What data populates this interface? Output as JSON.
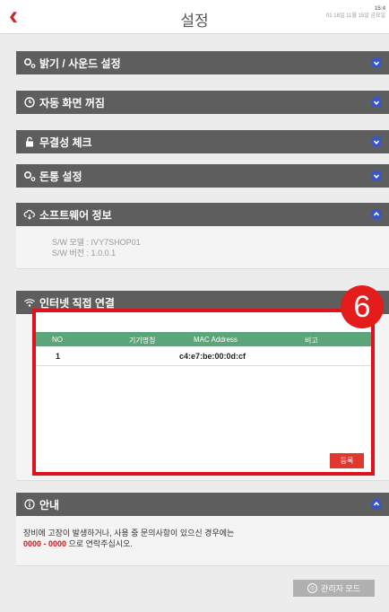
{
  "header": {
    "title": "설정",
    "clock_time": "15:4",
    "clock_date": "01 16일 11월 15일 금요일"
  },
  "sections": {
    "brightness": {
      "label": "밝기 / 사운드 설정"
    },
    "auto_off": {
      "label": "자동 화면 꺼짐"
    },
    "integrity": {
      "label": "무결성 체크"
    },
    "money": {
      "label": "돈통 설정"
    },
    "software": {
      "label": "소프트웨어 정보",
      "model": "S/W 모델 : IVY7SHOP01",
      "version": "S/W 버전 : 1.0.0.1"
    },
    "internet": {
      "label": "인터넷 직접 연결",
      "columns": [
        "NO",
        "기기명칭",
        "MAC Address",
        "비고"
      ],
      "rows": [
        {
          "no": "1",
          "name": "",
          "mac": "c4:e7:be:00:0d:cf",
          "note": ""
        }
      ],
      "register_label": "등록",
      "badge": "6"
    },
    "notice": {
      "label": "안내",
      "line1": "장비에 고장이 발생하거나, 사용 중 문의사항이 있으신 경우에는",
      "phone": "0000 - 0000",
      "line2_suffix": " 으로 연락주십시오."
    }
  },
  "footer": {
    "admin_label": "관리자 모드"
  },
  "colors": {
    "header_bg": "#5e5e5e",
    "toggle": "#3a55c8",
    "table_head": "#5aa579",
    "accent_red": "#e0111b"
  }
}
